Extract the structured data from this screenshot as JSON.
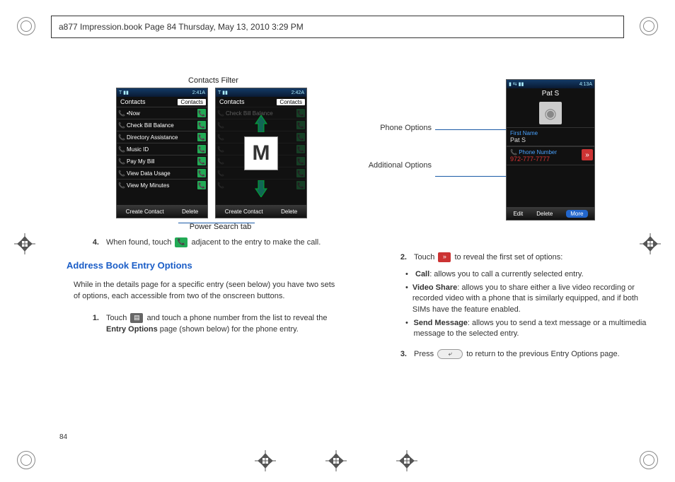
{
  "header": "a877 Impression.book  Page 84  Thursday, May 13, 2010  3:29 PM",
  "page_number": "84",
  "labels": {
    "contacts_filter": "Contacts Filter",
    "power_search_tab": "Power Search tab",
    "phone_options": "Phone Options",
    "additional_options": "Additional Options"
  },
  "phone1": {
    "time": "2:41A",
    "title_left": "Contacts",
    "title_pill": "Contacts",
    "rows": [
      "•Now",
      "Check Bill Balance",
      "Directory Assistance",
      "Music ID",
      "Pay My Bill",
      "View Data Usage",
      "View My Minutes"
    ],
    "btn_left": "Create Contact",
    "btn_right": "Delete"
  },
  "phone2": {
    "time": "2:42A",
    "title_left": "Contacts",
    "title_pill": "Contacts",
    "rows": [
      "Check Bill Balance",
      "",
      "",
      "",
      "",
      "",
      ""
    ],
    "big_letter": "M",
    "btn_left": "Create Contact",
    "btn_right": "Delete"
  },
  "phone3": {
    "time": "4:13A",
    "title": "Pat S",
    "field1_label": "First Name",
    "field1_value": "Pat S",
    "field2_label": "Phone Number",
    "field2_value": "972-777-7777",
    "btn_edit": "Edit",
    "btn_delete": "Delete",
    "btn_more": "More"
  },
  "left_col": {
    "step4": "When found, touch",
    "step4_after": "adjacent to the entry to make the call.",
    "heading": "Address Book Entry Options",
    "intro": "While in the details page for a specific entry (seen below) you have two sets of options, each accessible from two of the onscreen buttons.",
    "step1_a": "Touch",
    "step1_b": "and touch a phone number from the list to reveal the",
    "step1_bold": " Entry Options ",
    "step1_c": "page (shown below) for the phone entry."
  },
  "right_col": {
    "step2": "Touch",
    "step2_after": "to reveal the first set of options:",
    "bullets": [
      {
        "bold": "Call",
        "text": ": allows you to call a currently selected entry."
      },
      {
        "bold": "Video Share",
        "text": ": allows you to share either a live video recording or recorded video with a phone that is similarly equipped, and if both SIMs have the feature enabled."
      },
      {
        "bold": "Send Message",
        "text": ": allows you to send a text message or a multimedia message to the selected entry."
      }
    ],
    "step3_a": "Press",
    "step3_b": "to return to the previous Entry Options page."
  }
}
